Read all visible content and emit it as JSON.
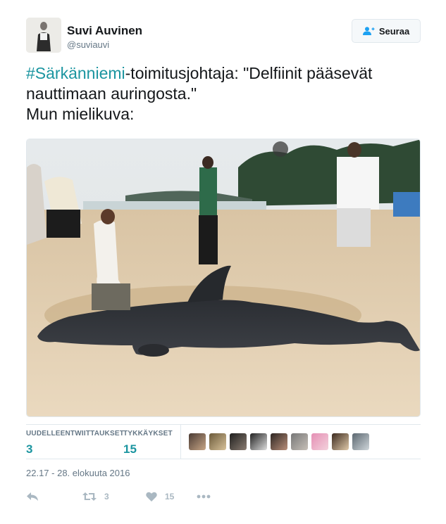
{
  "user": {
    "name": "Suvi Auvinen",
    "handle": "@suviauvi"
  },
  "follow_button": {
    "label": "Seuraa",
    "icon": "follow-user-icon"
  },
  "tweet": {
    "hashtag": "#Särkänniemi",
    "line1_rest": "-toimitusjohtaja: \"Delfiinit pääsevät",
    "line2": "nauttimaan auringosta.\"",
    "line3": "Mun mielikuva:"
  },
  "stats": {
    "retweets_label": "UUDELLEENTWIITTAUKSET",
    "retweets_value": "3",
    "likes_label": "TYKKÄYKSET",
    "likes_value": "15"
  },
  "timestamp": "22.17 - 28. elokuuta 2016",
  "actions": {
    "reply_icon": "reply-icon",
    "retweet_icon": "retweet-icon",
    "retweet_count": "3",
    "like_icon": "heart-icon",
    "like_count": "15",
    "more_icon": "more-dots-icon"
  },
  "colors": {
    "accent": "#1b95a0",
    "muted": "#657786",
    "icon": "#aab8c2"
  }
}
